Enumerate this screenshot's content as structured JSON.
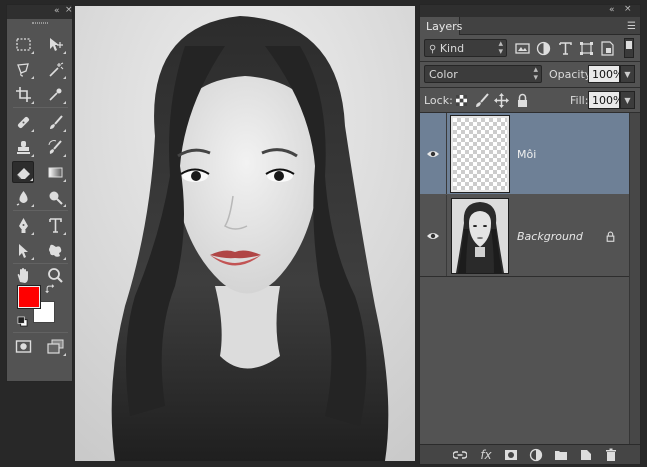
{
  "tools_panel": {
    "collapse_glyph": "«",
    "close_glyph": "×",
    "tools": [
      {
        "name": "rectangular-marquee-tool-icon"
      },
      {
        "name": "move-tool-icon"
      },
      {
        "name": "lasso-tool-icon"
      },
      {
        "name": "magic-wand-tool-icon"
      },
      {
        "name": "crop-tool-icon"
      },
      {
        "name": "eyedropper-tool-icon"
      },
      {
        "name": "healing-brush-tool-icon"
      },
      {
        "name": "brush-tool-icon"
      },
      {
        "name": "clone-stamp-tool-icon"
      },
      {
        "name": "history-brush-tool-icon"
      },
      {
        "name": "eraser-tool-icon",
        "active": true
      },
      {
        "name": "gradient-tool-icon"
      },
      {
        "name": "blur-tool-icon"
      },
      {
        "name": "dodge-tool-icon"
      },
      {
        "name": "pen-tool-icon"
      },
      {
        "name": "type-tool-icon"
      },
      {
        "name": "path-selection-tool-icon"
      },
      {
        "name": "custom-shape-tool-icon"
      },
      {
        "name": "hand-tool-icon"
      },
      {
        "name": "zoom-tool-icon"
      },
      {
        "name": "quick-mask-icon"
      },
      {
        "name": "screen-mode-icon"
      }
    ],
    "foreground_color": "#ff0000",
    "background_color": "#ffffff"
  },
  "layers_panel": {
    "collapse_glyph": "«",
    "close_glyph": "×",
    "tab_label": "Layers",
    "filter": {
      "label": "Kind"
    },
    "blend_mode": "Color",
    "opacity_label": "Opacity:",
    "opacity_value": "100%",
    "lock_label": "Lock:",
    "fill_label": "Fill:",
    "fill_value": "100%",
    "layers": [
      {
        "name": "Môi",
        "selected": true,
        "visible": true
      },
      {
        "name": "Background",
        "selected": false,
        "visible": true,
        "locked": true
      }
    ]
  },
  "colors": {
    "panel_bg": "#535353",
    "selected_layer": "#6e8096",
    "app_bg": "#282828"
  }
}
